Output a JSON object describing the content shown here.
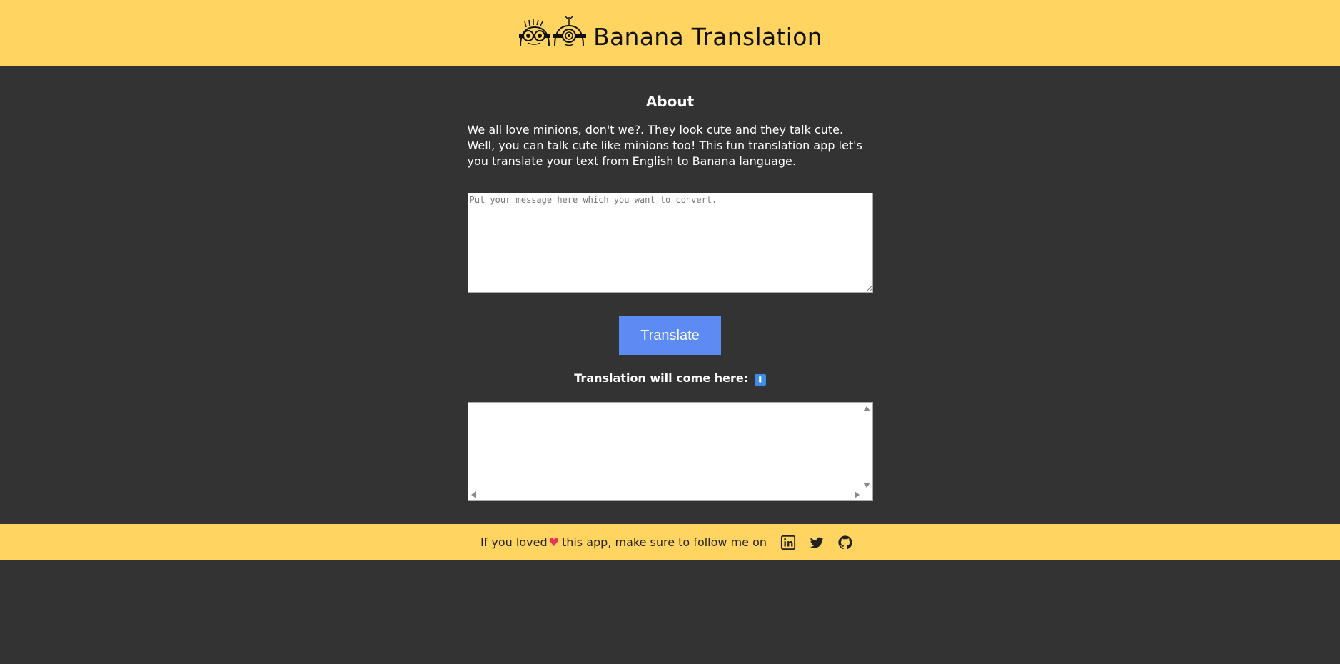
{
  "header": {
    "title": "Banana Translation",
    "logo_icon": "minions-icon",
    "background": "#FFD460"
  },
  "about": {
    "heading": "About",
    "text": "We all love minions, don't we?. They look cute and they talk cute. Well, you can talk cute like minions too! This fun translation app let's you translate your text from English to Banana language."
  },
  "input": {
    "placeholder": "Put your message here which you want to convert.",
    "value": ""
  },
  "translate_button": {
    "label": "Translate",
    "color": "#5D8BF4"
  },
  "output": {
    "label": "Translation will come here:",
    "arrow_icon": "down-arrow-emoji-icon",
    "value": ""
  },
  "footer": {
    "text_before": "If you loved",
    "heart": "♥",
    "text_after": "this app, make sure to follow me on",
    "social": [
      {
        "name": "linkedin-icon"
      },
      {
        "name": "twitter-icon"
      },
      {
        "name": "github-icon"
      }
    ]
  }
}
